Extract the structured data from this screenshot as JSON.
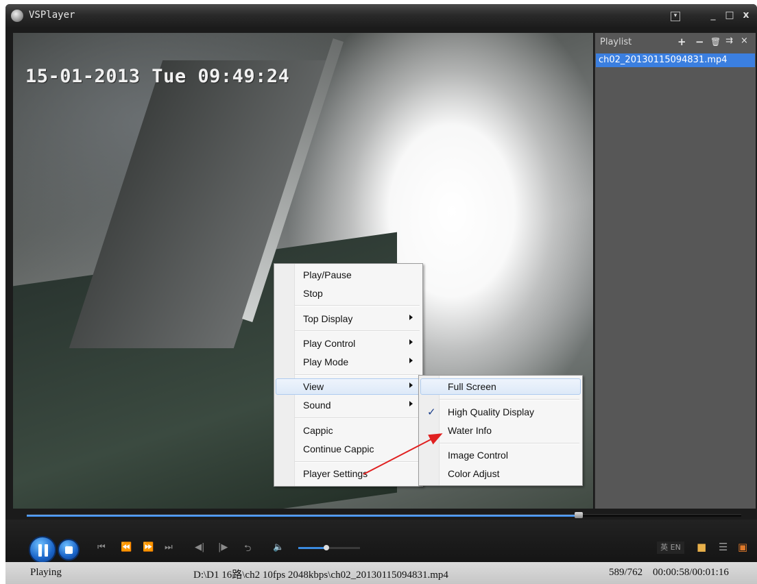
{
  "window": {
    "title": "VSPlayer"
  },
  "titlebar_buttons": {
    "menu_glyph": "▾",
    "minimize_glyph": "_",
    "maximize_glyph": "□",
    "close_glyph": "x"
  },
  "video": {
    "osd_timestamp": "15-01-2013  Tue  09:49:24"
  },
  "playlist": {
    "header_label": "Playlist",
    "icons": [
      "plus-icon",
      "minus-icon",
      "trash-icon",
      "sort-icon",
      "close-icon"
    ],
    "items": [
      {
        "label": "ch02_20130115094831.mp4",
        "selected": true
      }
    ]
  },
  "context_menu": {
    "items": [
      {
        "label": "Play/Pause"
      },
      {
        "label": "Stop"
      },
      {
        "label": "Top Display",
        "submenu": true
      },
      {
        "label": "Play Control",
        "submenu": true
      },
      {
        "label": "Play Mode",
        "submenu": true
      },
      {
        "label": "View",
        "submenu": true,
        "highlighted": true
      },
      {
        "label": "Sound",
        "submenu": true
      },
      {
        "label": "Cappic"
      },
      {
        "label": "Continue Cappic"
      },
      {
        "label": "Player Settings"
      }
    ]
  },
  "view_submenu": {
    "items": [
      {
        "label": "Full Screen",
        "highlighted": true
      },
      {
        "label": "High Quality Display",
        "checked": true
      },
      {
        "label": "Water Info"
      },
      {
        "label": "Image Control"
      },
      {
        "label": "Color Adjust"
      }
    ]
  },
  "seek": {
    "progress": 0.773
  },
  "controls": {
    "volume_level": 0.45,
    "language_label": "英 EN",
    "buttons": [
      "pause-button",
      "stop-button",
      "previous-file-button",
      "rewind-button",
      "fast-forward-button",
      "next-file-button",
      "step-back-button",
      "step-forward-button",
      "repeat-button",
      "volume-button"
    ]
  },
  "status": {
    "state": "Playing",
    "file_info": "D:\\D1 16路\\ch2 10fps 2048kbps\\ch02_20130115094831.mp4",
    "frames": "589/762",
    "time": "00:00:58/00:01:16"
  },
  "colors": {
    "accent": "#3b7fe0",
    "annotation_arrow": "#e02020",
    "playlist_bg": "#575757"
  }
}
